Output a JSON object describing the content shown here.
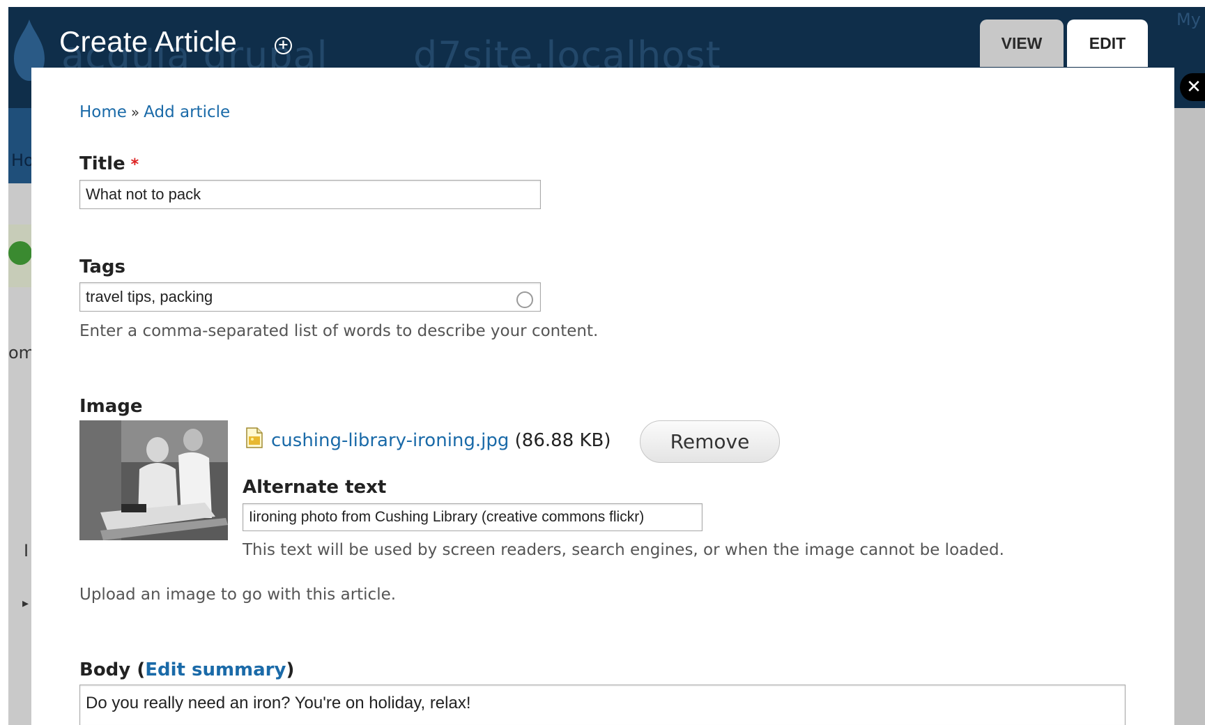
{
  "background": {
    "site_name": "acquia drupal",
    "site_domain": "d7site.localhost",
    "top_right_text": "My",
    "nav_fragment": "Ho",
    "side_fragment": "om",
    "side_fragment_2": "I",
    "side_fragment_3": "▸"
  },
  "overlay": {
    "title": "Create Article",
    "add_icon": "+",
    "tabs": [
      {
        "label": "VIEW",
        "active": false
      },
      {
        "label": "EDIT",
        "active": true
      }
    ],
    "close_icon": "✕"
  },
  "breadcrumb": {
    "home": "Home",
    "separator": "»",
    "current": "Add article"
  },
  "form": {
    "title": {
      "label": "Title",
      "required_marker": "*",
      "value": "What not to pack"
    },
    "tags": {
      "label": "Tags",
      "value": "travel tips, packing",
      "description": "Enter a comma-separated list of words to describe your content."
    },
    "image": {
      "label": "Image",
      "file_name": "cushing-library-ironing.jpg",
      "file_size": "(86.88 KB)",
      "remove_label": "Remove",
      "alt_label": "Alternate text",
      "alt_value": "Iironing photo from Cushing Library (creative commons flickr)",
      "alt_description": "This text will be used by screen readers, search engines, or when the image cannot be loaded.",
      "description": "Upload an image to go with this article."
    },
    "body": {
      "label": "Body",
      "paren_open": "(",
      "edit_summary": "Edit summary",
      "paren_close": ")",
      "value": "Do you really need an iron? You're on holiday, relax!"
    }
  },
  "colors": {
    "header_bg": "#0f2e4a",
    "link": "#1a6aa8",
    "required": "#dd2222"
  }
}
